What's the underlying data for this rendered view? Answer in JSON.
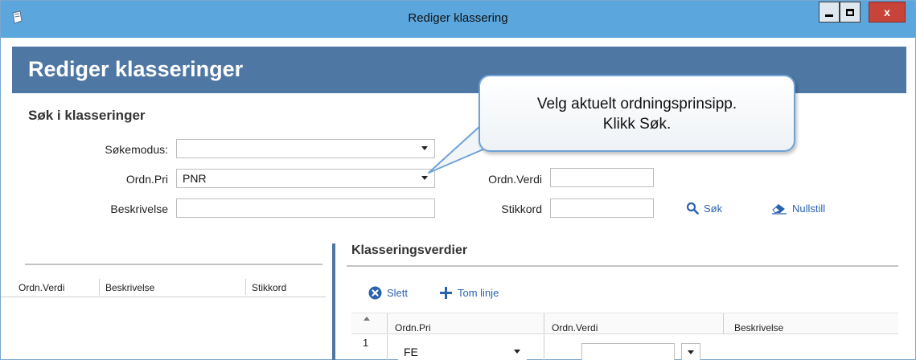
{
  "window": {
    "title": "Rediger klassering",
    "close_label": "x"
  },
  "header": {
    "title": "Rediger klasseringer"
  },
  "search": {
    "section_title": "Søk i klasseringer",
    "sokemodus_label": "Søkemodus:",
    "sokemodus_value": "",
    "ordnpri_label": "Ordn.Pri",
    "ordnpri_value": "PNR",
    "beskrivelse_label": "Beskrivelse",
    "beskrivelse_value": "",
    "ordnverdi_label": "Ordn.Verdi",
    "ordnverdi_value": "",
    "stikkord_label": "Stikkord",
    "stikkord_value": "",
    "search_button": "Søk",
    "reset_button": "Nullstill"
  },
  "callout": {
    "line1": "Velg aktuelt ordningsprinsipp.",
    "line2": "Klikk Søk."
  },
  "left_list": {
    "columns": [
      "Ordn.Verdi",
      "Beskrivelse",
      "Stikkord"
    ]
  },
  "values_panel": {
    "title": "Klasseringsverdier",
    "delete_button": "Slett",
    "add_button": "Tom linje",
    "columns": [
      "Ordn.Pri",
      "Ordn.Verdi",
      "Beskrivelse"
    ],
    "rows": [
      {
        "num": "1",
        "ordnpri": "FE",
        "ordnverdi": ""
      }
    ]
  },
  "colors": {
    "titlebar": "#5aa6dd",
    "header": "#4f77a4",
    "link": "#2a62b0",
    "close": "#c8443b"
  }
}
